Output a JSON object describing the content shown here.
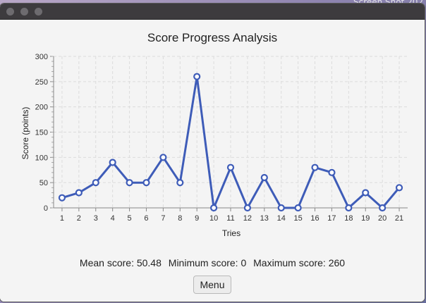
{
  "desktop": {
    "label": "Screen Shot 202"
  },
  "window": {
    "title": ""
  },
  "stats": {
    "mean": "Mean score: 50.48",
    "min": "Minimum score: 0",
    "max": "Maximum score: 260"
  },
  "menu_button": {
    "label": "Menu"
  },
  "colors": {
    "series": "#3e5cb8",
    "grid": "#dcdcdc",
    "text": "#222222"
  },
  "chart_data": {
    "type": "line",
    "title": "Score Progress Analysis",
    "xlabel": "Tries",
    "ylabel": "Score (points)",
    "x": [
      1,
      2,
      3,
      4,
      5,
      6,
      7,
      8,
      9,
      10,
      11,
      12,
      13,
      14,
      15,
      16,
      17,
      18,
      19,
      20,
      21
    ],
    "values": [
      20,
      30,
      50,
      90,
      50,
      50,
      100,
      50,
      260,
      0,
      80,
      0,
      60,
      0,
      0,
      80,
      70,
      0,
      30,
      0,
      40
    ],
    "ylim": [
      0,
      300
    ],
    "yticks": [
      0,
      50,
      100,
      150,
      200,
      250,
      300
    ],
    "grid": true,
    "legend": "none"
  }
}
